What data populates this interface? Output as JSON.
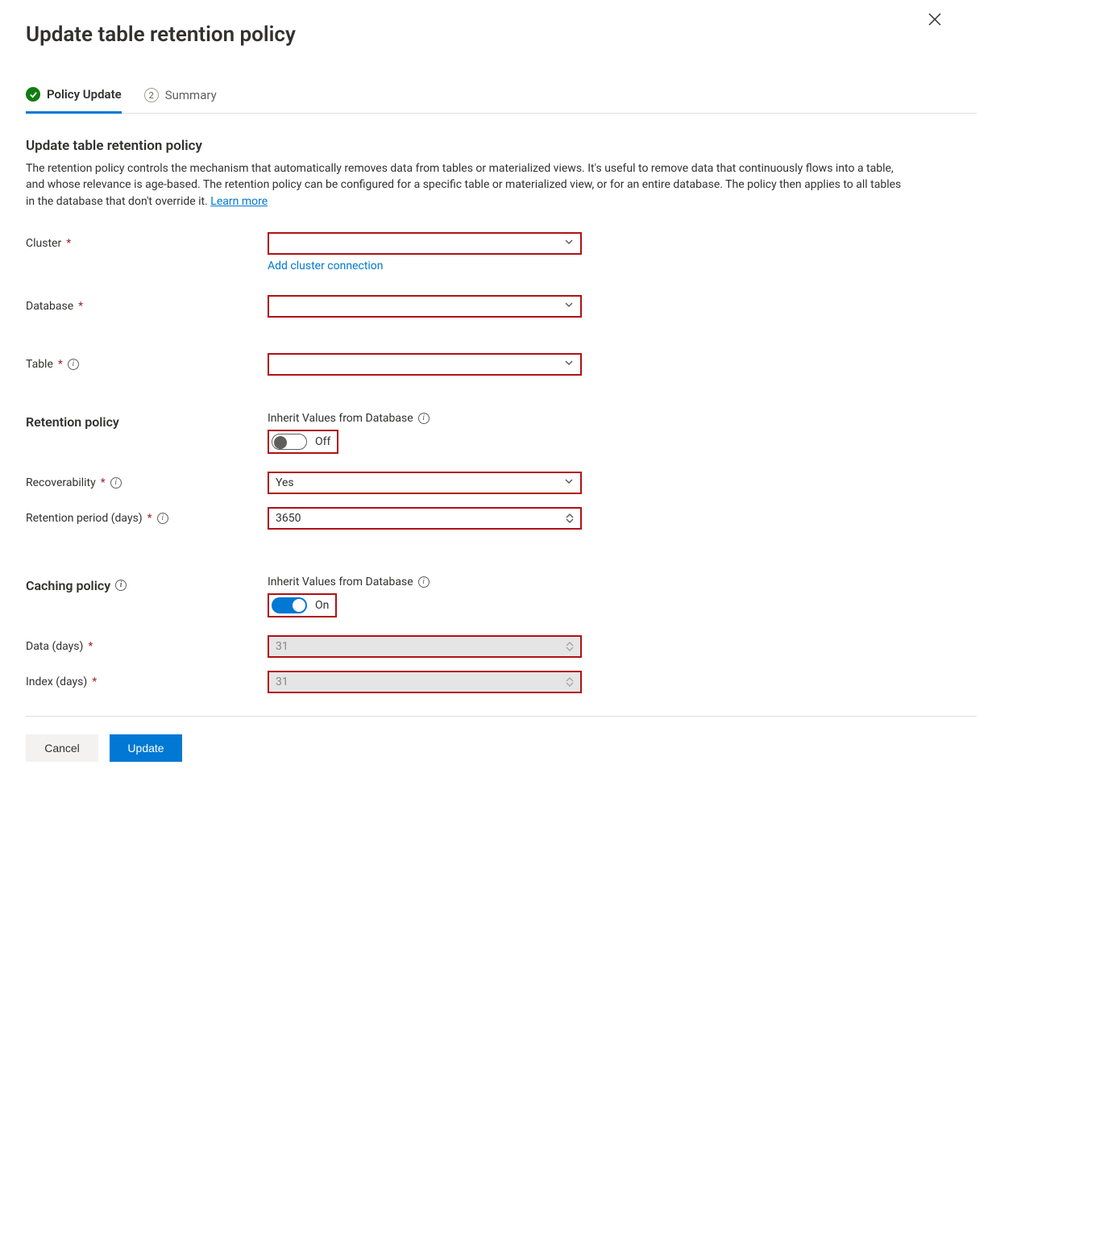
{
  "header": {
    "title": "Update table retention policy"
  },
  "steps": {
    "active": "Policy Update",
    "inactive_num": "2",
    "inactive_label": "Summary"
  },
  "intro": {
    "heading": "Update table retention policy",
    "desc": "The retention policy controls the mechanism that automatically removes data from tables or materialized views. It's useful to remove data that continuously flows into a table, and whose relevance is age-based. The retention policy can be configured for a specific table or materialized view, or for an entire database. The policy then applies to all tables in the database that don't override it. ",
    "learn_more": "Learn more"
  },
  "fields": {
    "cluster_label": "Cluster",
    "cluster_value": "",
    "add_cluster_link": "Add cluster connection",
    "database_label": "Database",
    "database_value": "",
    "table_label": "Table",
    "table_value": ""
  },
  "retention": {
    "section_label": "Retention policy",
    "inherit_label": "Inherit Values from Database",
    "inherit_state": "Off",
    "recoverability_label": "Recoverability",
    "recoverability_value": "Yes",
    "period_label": "Retention period (days)",
    "period_value": "3650"
  },
  "caching": {
    "section_label": "Caching policy",
    "inherit_label": "Inherit Values from Database",
    "inherit_state": "On",
    "data_label": "Data (days)",
    "data_value": "31",
    "index_label": "Index (days)",
    "index_value": "31"
  },
  "footer": {
    "cancel": "Cancel",
    "update": "Update"
  }
}
